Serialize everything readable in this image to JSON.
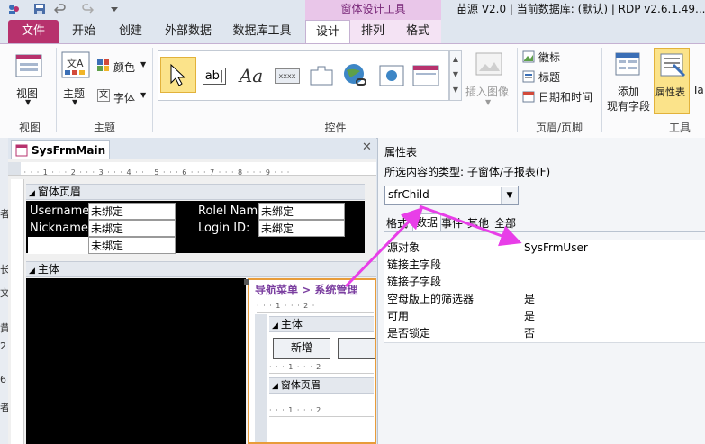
{
  "window": {
    "title": "苗源 V2.0 | 当前数据库: (默认) | RDP v2.6.1.49...",
    "contextual_tab_group": "窗体设计工具"
  },
  "ribbon": {
    "tabs": [
      "文件",
      "开始",
      "创建",
      "外部数据",
      "数据库工具",
      "设计",
      "排列",
      "格式"
    ],
    "active_tab": "设计",
    "groups": {
      "views": {
        "label": "视图",
        "view_button": "视图"
      },
      "themes": {
        "label": "主题",
        "theme_button": "主题",
        "colors_button": "颜色",
        "fonts_button": "字体"
      },
      "controls": {
        "label": "控件",
        "insert_image": "插入图像",
        "textbox_glyph": "ab|",
        "label_glyph": "Aa",
        "button_glyph": "xxxx"
      },
      "header_footer": {
        "label": "页眉/页脚",
        "logo": "徽标",
        "title": "标题",
        "date_time": "日期和时间"
      },
      "tools": {
        "label": "工具",
        "add_existing_fields_line1": "添加",
        "add_existing_fields_line2": "现有字段",
        "property_sheet": "属性表",
        "tab_order": "Ta"
      }
    }
  },
  "document": {
    "tab_title": "SysFrmMain",
    "form_header_label": "窗体页眉",
    "detail_label": "主体",
    "fields": {
      "username_label": "Username:",
      "username_value": "未绑定",
      "nickname_label": "Nickname:",
      "nickname_value": "未绑定",
      "third_value": "未绑定",
      "role_label": "Rolel Name",
      "role_value": "未绑定",
      "login_label": "Login ID:",
      "login_value": "未绑定"
    },
    "subform": {
      "breadcrumb": "导航菜单 > 系统管理",
      "detail_label": "主体",
      "new_button": "新增",
      "form_header_label": "窗体页眉"
    },
    "left_strip_chars": [
      "者",
      "长",
      "文",
      "黄",
      "2",
      "6",
      "者"
    ]
  },
  "property_sheet": {
    "title": "属性表",
    "selection_type_label": "所选内容的类型:",
    "selection_type_value": "子窗体/子报表(F)",
    "object_selected": "sfrChild",
    "tabs": [
      "格式",
      "数据",
      "事件",
      "其他",
      "全部"
    ],
    "active_tab": "数据",
    "rows": [
      {
        "name": "源对象",
        "value": "SysFrmUser"
      },
      {
        "name": "链接主字段",
        "value": ""
      },
      {
        "name": "链接子字段",
        "value": ""
      },
      {
        "name": "空母版上的筛选器",
        "value": "是"
      },
      {
        "name": "可用",
        "value": "是"
      },
      {
        "name": "是否锁定",
        "value": "否"
      }
    ]
  },
  "colors": {
    "file_tab": "#b7326d",
    "contextual": "#e9c6e9",
    "annotation_arrow": "#e83ee8"
  }
}
